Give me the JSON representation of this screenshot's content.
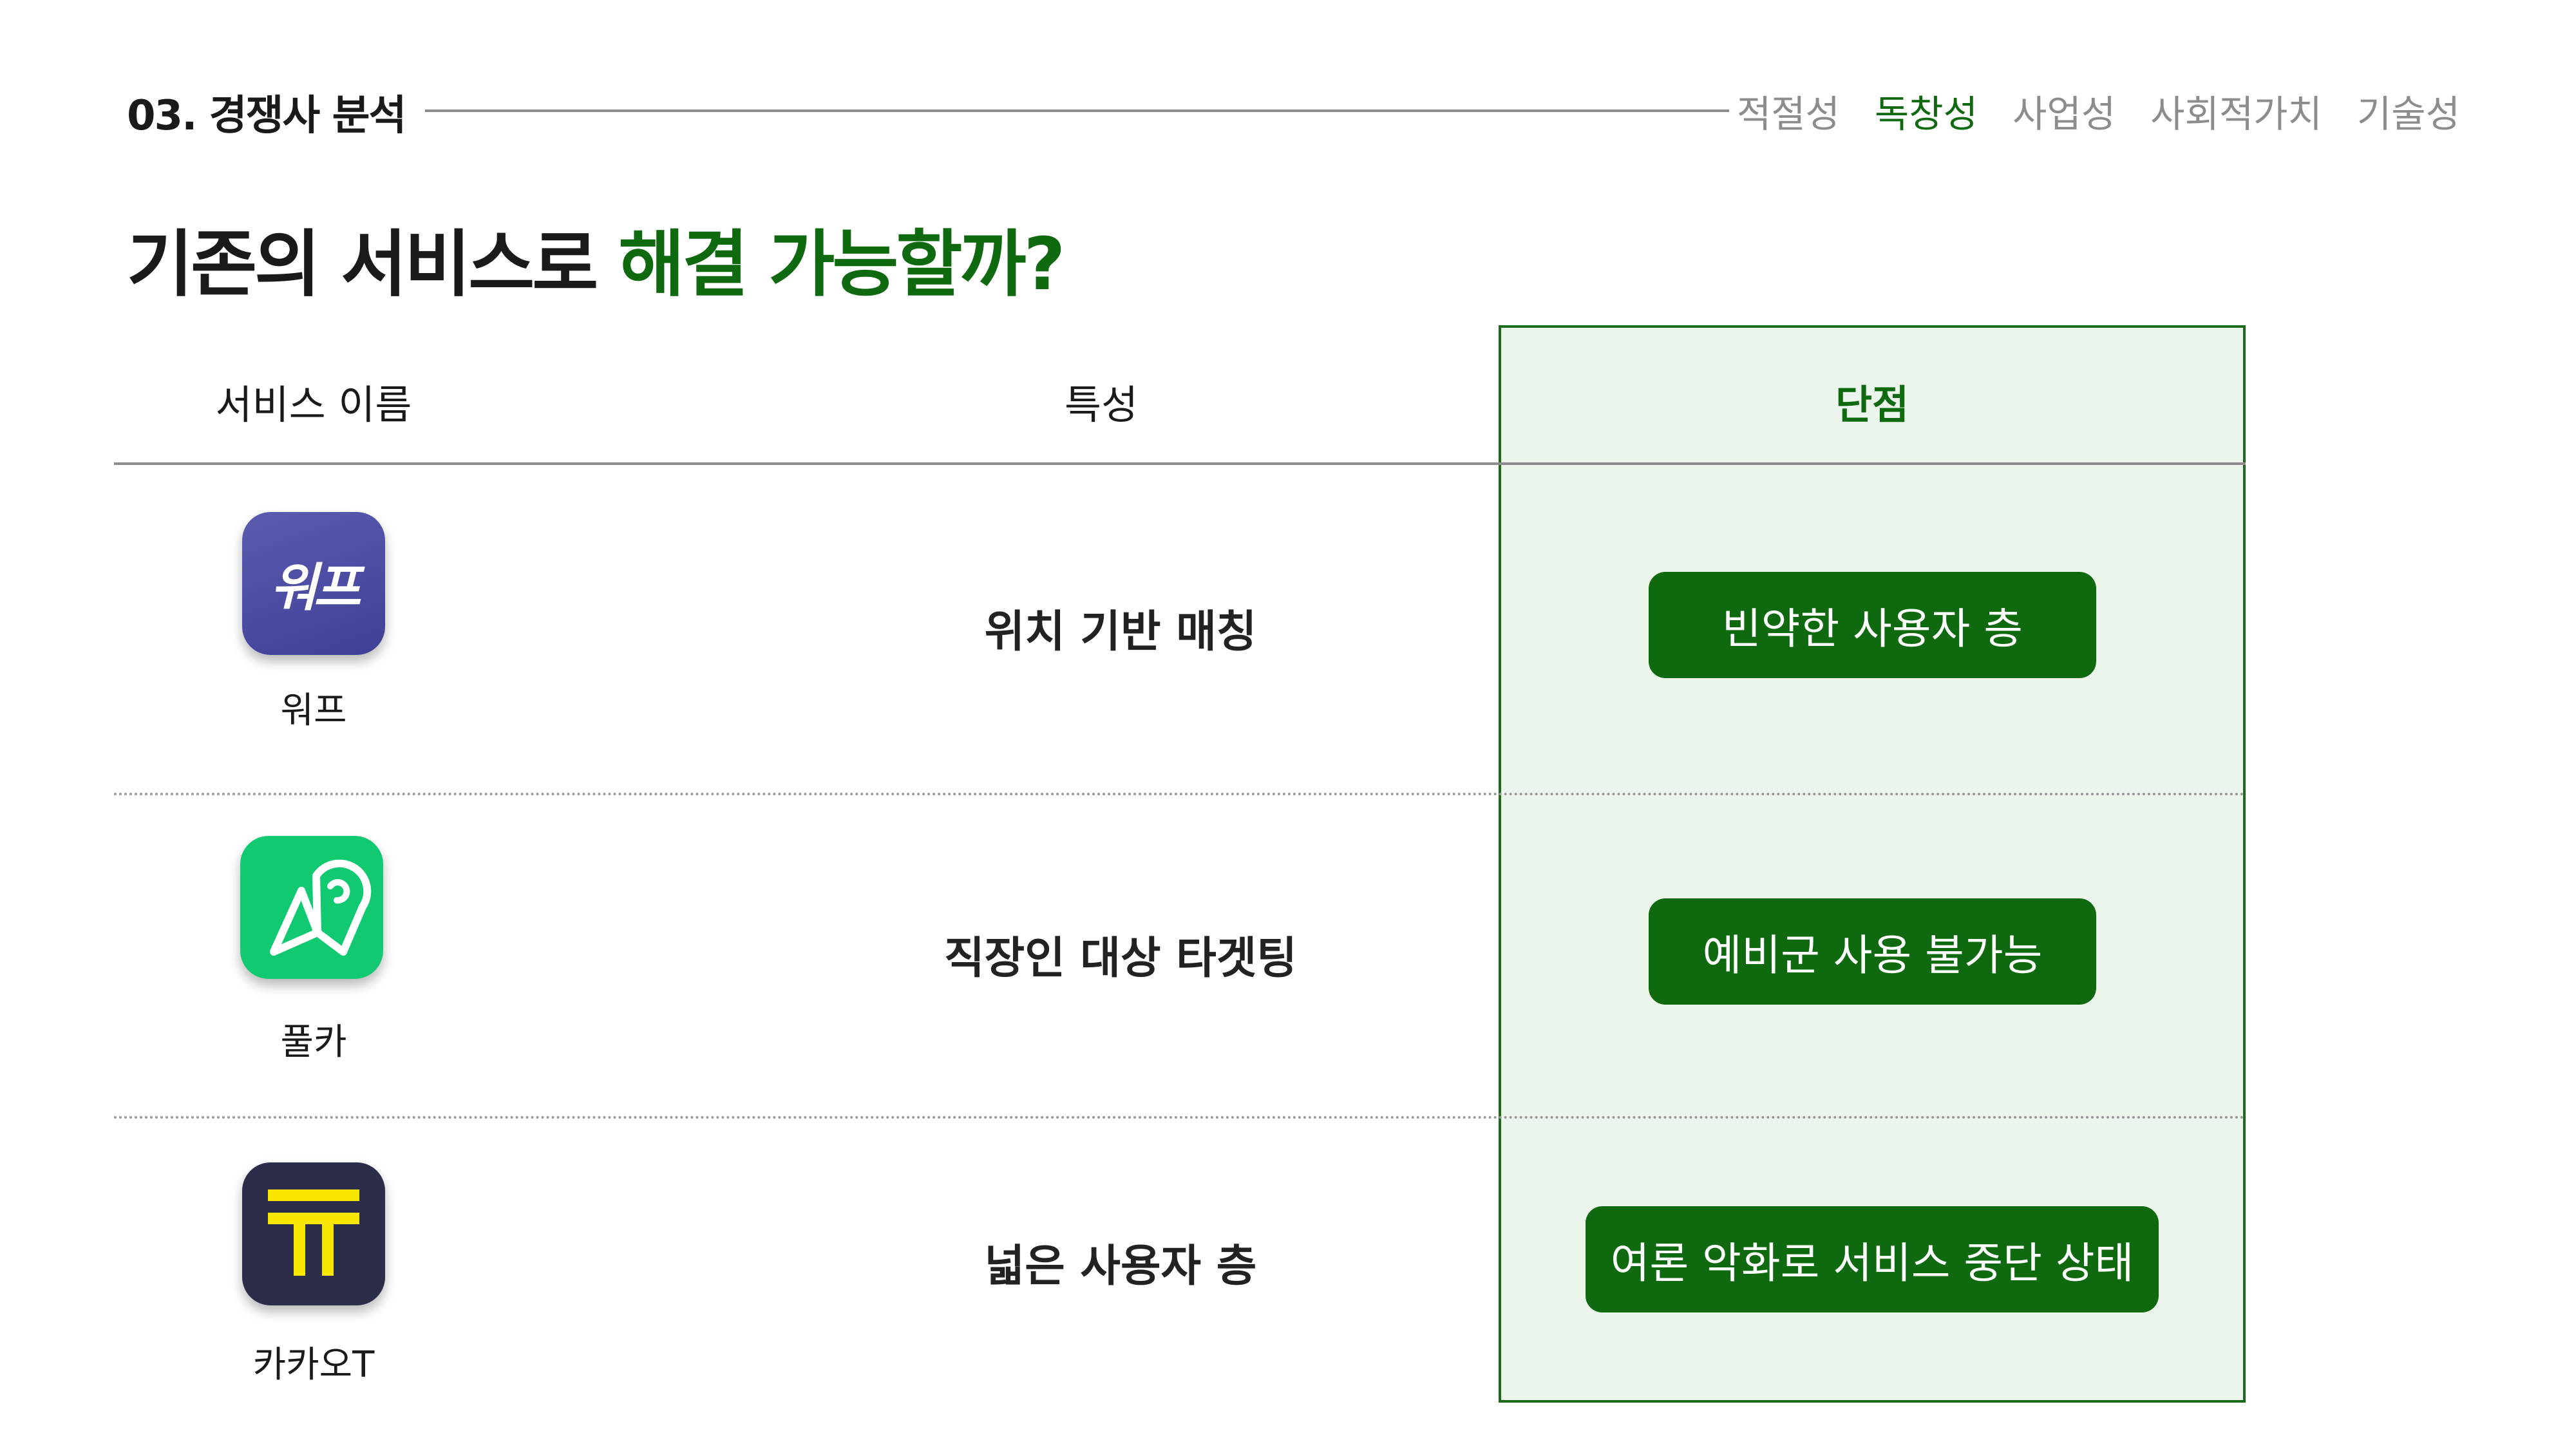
{
  "header": {
    "section_label": "03. 경쟁사 분석",
    "nav": [
      "적절성",
      "독창성",
      "사업성",
      "사회적가치",
      "기술성"
    ],
    "active_nav": 1
  },
  "title": {
    "part1": "기존의 서비스로 ",
    "part2": "해결 가능할까?"
  },
  "table": {
    "headers": {
      "name": "서비스 이름",
      "feature": "특성",
      "cons": "단점"
    },
    "rows": [
      {
        "name": "워프",
        "icon": "wepeu-app-icon",
        "icon_text": "워프",
        "feature": "위치 기반 매칭",
        "con": "빈약한 사용자 층"
      },
      {
        "name": "풀카",
        "icon": "location-pin-icon",
        "feature": "직장인 대상 타겟팅",
        "con": "예비군 사용 불가능"
      },
      {
        "name": "카카오T",
        "icon": "kakao-t-icon",
        "feature": "넓은 사용자 층",
        "con": "여론 악화로 서비스 중단 상태"
      }
    ]
  },
  "colors": {
    "accent": "#0f6a0f",
    "muted": "#8c8c8c",
    "highlight_bg": "#ecf5ec"
  }
}
